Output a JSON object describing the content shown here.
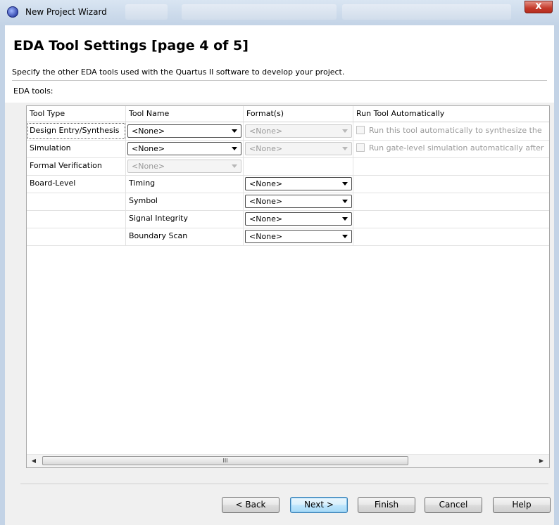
{
  "window": {
    "title": "New Project Wizard",
    "close_glyph": "X",
    "icon": "quartus-icon"
  },
  "header": {
    "title": "EDA Tool Settings [page 4 of 5]",
    "description": "Specify the other EDA tools used with the Quartus II software to develop your project."
  },
  "eda_label": "EDA tools:",
  "table": {
    "columns": [
      "Tool Type",
      "Tool Name",
      "Format(s)",
      "Run Tool Automatically"
    ],
    "rows": [
      {
        "type": "Design Entry/Synthesis",
        "tool_name": "<None>",
        "format": "<None>",
        "run_text": "Run this tool automatically to synthesize the"
      },
      {
        "type": "Simulation",
        "tool_name": "<None>",
        "format": "<None>",
        "run_text": "Run gate-level simulation automatically after"
      },
      {
        "type": "Formal Verification",
        "tool_name": "<None>"
      },
      {
        "type": "Board-Level",
        "tool_name": "Timing",
        "format": "<None>"
      },
      {
        "type": "",
        "tool_name": "Symbol",
        "format": "<None>"
      },
      {
        "type": "",
        "tool_name": "Signal Integrity",
        "format": "<None>"
      },
      {
        "type": "",
        "tool_name": "Boundary Scan",
        "format": "<None>"
      }
    ],
    "scroll_grip": "III"
  },
  "buttons": {
    "back": "< Back",
    "next": "Next >",
    "finish": "Finish",
    "cancel": "Cancel",
    "help": "Help"
  }
}
